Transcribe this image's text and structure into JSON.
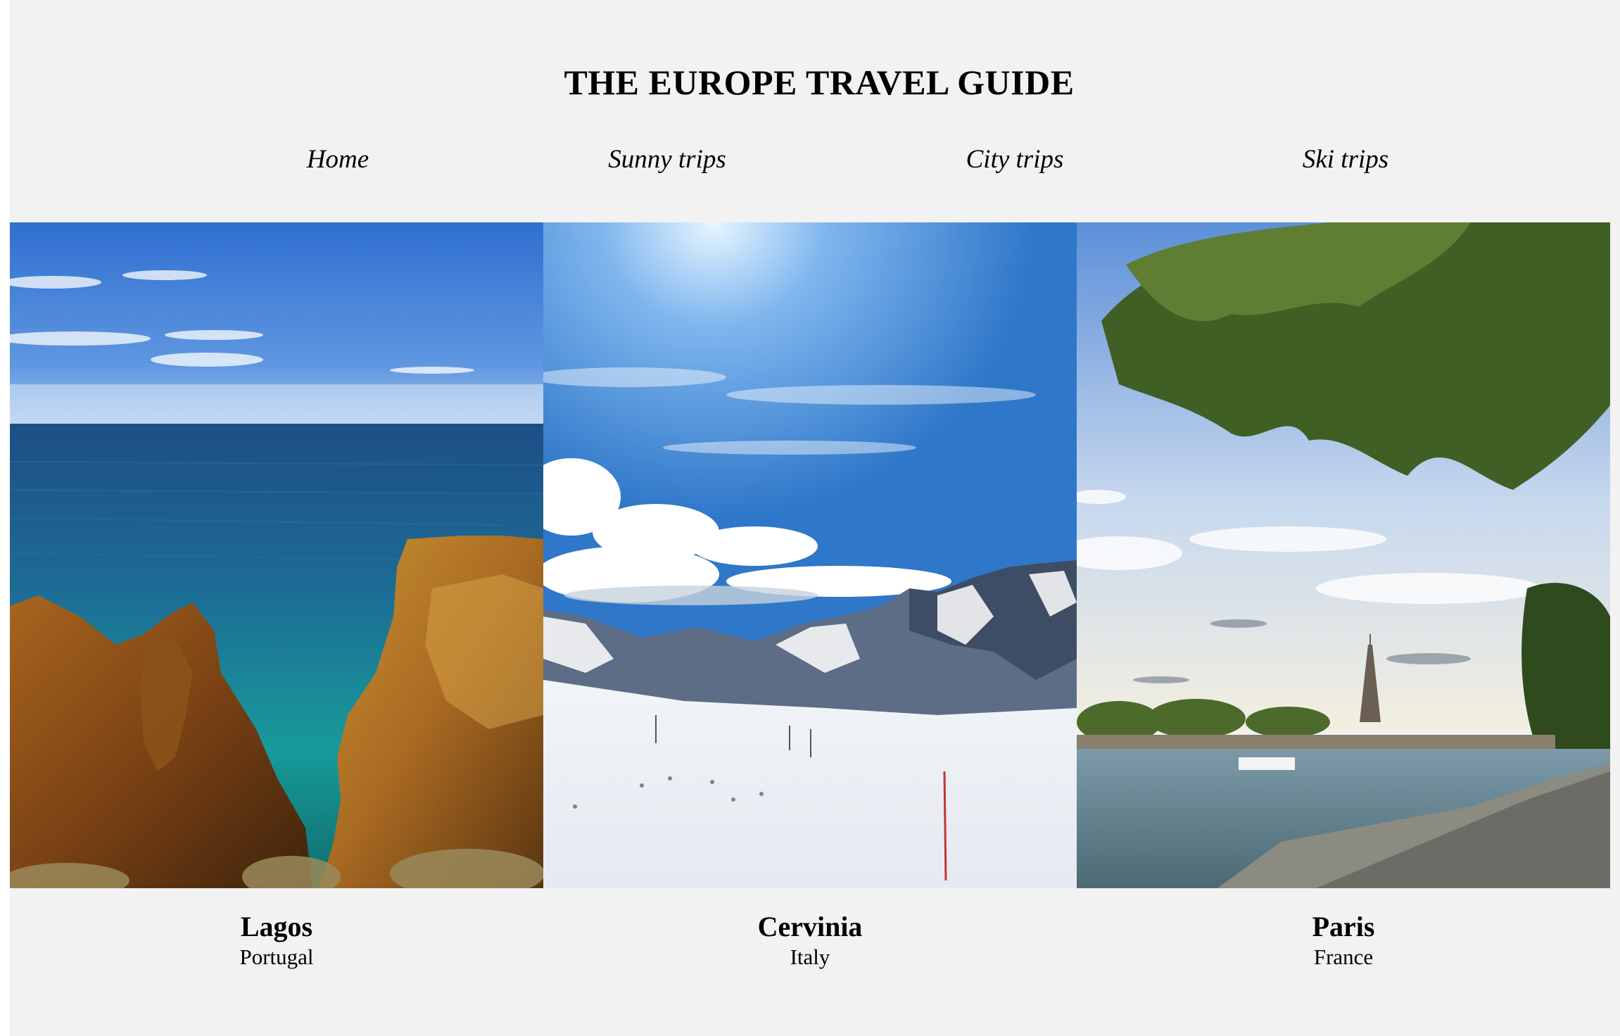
{
  "header": {
    "title": "THE EUROPE TRAVEL GUIDE"
  },
  "nav": {
    "items": [
      {
        "label": "Home"
      },
      {
        "label": "Sunny trips"
      },
      {
        "label": "City trips"
      },
      {
        "label": "Ski trips"
      }
    ]
  },
  "destinations": [
    {
      "city": "Lagos",
      "country": "Portugal"
    },
    {
      "city": "Cervinia",
      "country": "Italy"
    },
    {
      "city": "Paris",
      "country": "France"
    }
  ],
  "colors": {
    "page_background": "#f2f2f2",
    "text": "#000000"
  }
}
